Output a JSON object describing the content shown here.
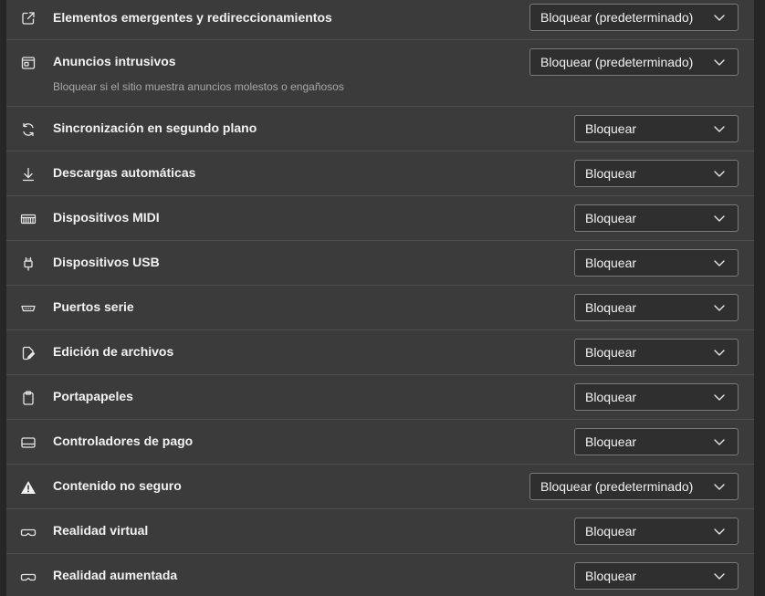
{
  "settings": [
    {
      "id": "popups",
      "icon": "external-window-icon",
      "label": "Elementos emergentes y redireccionamientos",
      "value": "Bloquear (predeterminado)"
    },
    {
      "id": "intrusive-ads",
      "icon": "ad-window-icon",
      "label": "Anuncios intrusivos",
      "sub": "Bloquear si el sitio muestra anuncios molestos o engañosos",
      "value": "Bloquear (predeterminado)"
    },
    {
      "id": "background-sync",
      "icon": "sync-icon",
      "label": "Sincronización en segundo plano",
      "value": "Bloquear"
    },
    {
      "id": "auto-downloads",
      "icon": "download-icon",
      "label": "Descargas automáticas",
      "value": "Bloquear"
    },
    {
      "id": "midi",
      "icon": "piano-keys-icon",
      "label": "Dispositivos MIDI",
      "value": "Bloquear"
    },
    {
      "id": "usb",
      "icon": "usb-icon",
      "label": "Dispositivos USB",
      "value": "Bloquear"
    },
    {
      "id": "serial",
      "icon": "serial-port-icon",
      "label": "Puertos serie",
      "value": "Bloquear"
    },
    {
      "id": "file-editing",
      "icon": "file-edit-icon",
      "label": "Edición de archivos",
      "value": "Bloquear"
    },
    {
      "id": "clipboard",
      "icon": "clipboard-icon",
      "label": "Portapapeles",
      "value": "Bloquear"
    },
    {
      "id": "payment-handlers",
      "icon": "card-icon",
      "label": "Controladores de pago",
      "value": "Bloquear"
    },
    {
      "id": "insecure-content",
      "icon": "warning-icon",
      "label": "Contenido no seguro",
      "value": "Bloquear (predeterminado)"
    },
    {
      "id": "vr",
      "icon": "vr-headset-icon",
      "label": "Realidad virtual",
      "value": "Bloquear"
    },
    {
      "id": "ar",
      "icon": "ar-headset-icon",
      "label": "Realidad aumentada",
      "value": "Bloquear"
    }
  ]
}
